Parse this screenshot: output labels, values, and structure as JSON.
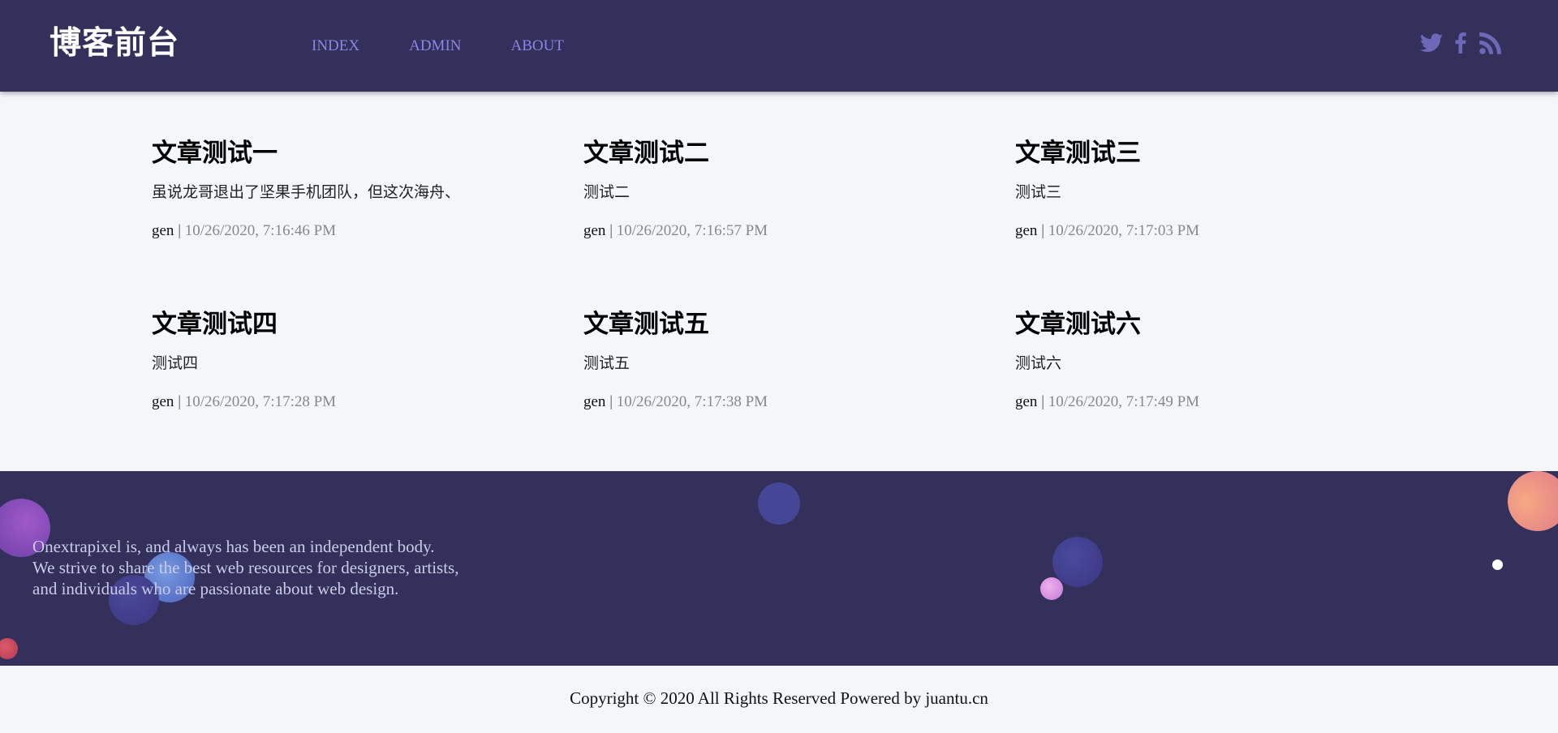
{
  "header": {
    "brand": "博客前台",
    "nav": [
      {
        "label": "INDEX"
      },
      {
        "label": "ADMIN"
      },
      {
        "label": "ABOUT"
      }
    ],
    "social_icons": [
      "twitter-icon",
      "facebook-icon",
      "rss-icon"
    ]
  },
  "posts": [
    {
      "title": "文章测试一",
      "excerpt": "虽说龙哥退出了坚果手机团队，但这次海舟、",
      "author": "gen",
      "separator": "|",
      "date": "10/26/2020, 7:16:46 PM"
    },
    {
      "title": "文章测试二",
      "excerpt": "测试二",
      "author": "gen",
      "separator": "|",
      "date": "10/26/2020, 7:16:57 PM"
    },
    {
      "title": "文章测试三",
      "excerpt": "测试三",
      "author": "gen",
      "separator": "|",
      "date": "10/26/2020, 7:17:03 PM"
    },
    {
      "title": "文章测试四",
      "excerpt": "测试四",
      "author": "gen",
      "separator": "|",
      "date": "10/26/2020, 7:17:28 PM"
    },
    {
      "title": "文章测试五",
      "excerpt": "测试五",
      "author": "gen",
      "separator": "|",
      "date": "10/26/2020, 7:17:38 PM"
    },
    {
      "title": "文章测试六",
      "excerpt": "测试六",
      "author": "gen",
      "separator": "|",
      "date": "10/26/2020, 7:17:49 PM"
    }
  ],
  "footer": {
    "lines": [
      "Onextrapixel is, and always has been an independent body.",
      "We strive to share the best web resources for designers, artists,",
      "and individuals who are passionate about web design."
    ],
    "copyright": "Copyright © 2020 All Rights Reserved Powered by juantu.cn"
  },
  "colors": {
    "header_bg": "#34305c",
    "nav_link": "#8c84e6",
    "social_icon": "#6e68b8",
    "page_bg": "#f4f7fa",
    "meta_date": "#888888"
  }
}
